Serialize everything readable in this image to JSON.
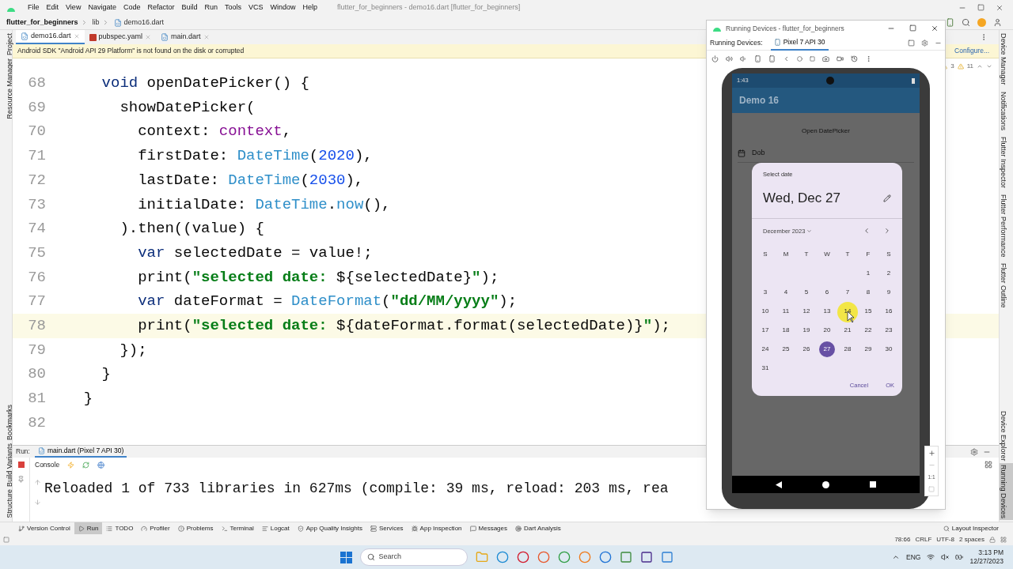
{
  "ide": {
    "menus": [
      "File",
      "Edit",
      "View",
      "Navigate",
      "Code",
      "Refactor",
      "Build",
      "Run",
      "Tools",
      "VCS",
      "Window",
      "Help"
    ],
    "title": "flutter_for_beginners - demo16.dart [flutter_for_beginners]",
    "breadcrumbs": [
      "flutter_for_beginners",
      "lib",
      "demo16.dart"
    ],
    "left_stripe": {
      "top": [
        "Project",
        "Resource Manager"
      ],
      "bottom": [
        "Bookmarks",
        "Build Variants",
        "Structure"
      ]
    },
    "editor_tabs": [
      {
        "label": "demo16.dart",
        "selected": true,
        "kind": "dart"
      },
      {
        "label": "pubspec.yaml",
        "selected": false,
        "kind": "yaml"
      },
      {
        "label": "main.dart",
        "selected": false,
        "kind": "dart"
      }
    ],
    "warning": {
      "text": "Android SDK \"Android API 29 Platform\" is not found on the disk or corrupted",
      "action": "Configure..."
    },
    "inspections": {
      "weak": "3",
      "warnings": "11"
    },
    "code_lines": [
      {
        "number": "68",
        "current": false,
        "tokens": [
          {
            "kind": "keyword",
            "text": "    void"
          },
          {
            "kind": "plain",
            "text": " openDatePicker() {"
          }
        ]
      },
      {
        "number": "69",
        "current": false,
        "tokens": [
          {
            "kind": "plain",
            "text": "      showDatePicker("
          }
        ]
      },
      {
        "number": "70",
        "current": false,
        "tokens": [
          {
            "kind": "plain",
            "text": "        context: "
          },
          {
            "kind": "param",
            "text": "context"
          },
          {
            "kind": "plain",
            "text": ","
          }
        ]
      },
      {
        "number": "71",
        "current": false,
        "tokens": [
          {
            "kind": "plain",
            "text": "        firstDate: "
          },
          {
            "kind": "type",
            "text": "DateTime"
          },
          {
            "kind": "plain",
            "text": "("
          },
          {
            "kind": "number",
            "text": "2020"
          },
          {
            "kind": "plain",
            "text": "),"
          }
        ]
      },
      {
        "number": "72",
        "current": false,
        "tokens": [
          {
            "kind": "plain",
            "text": "        lastDate: "
          },
          {
            "kind": "type",
            "text": "DateTime"
          },
          {
            "kind": "plain",
            "text": "("
          },
          {
            "kind": "number",
            "text": "2030"
          },
          {
            "kind": "plain",
            "text": "),"
          }
        ]
      },
      {
        "number": "73",
        "current": false,
        "tokens": [
          {
            "kind": "plain",
            "text": "        initialDate: "
          },
          {
            "kind": "type",
            "text": "DateTime"
          },
          {
            "kind": "plain",
            "text": "."
          },
          {
            "kind": "type",
            "text": "now"
          },
          {
            "kind": "plain",
            "text": "(),"
          }
        ]
      },
      {
        "number": "74",
        "current": false,
        "tokens": [
          {
            "kind": "plain",
            "text": "      ).then((value) {"
          }
        ]
      },
      {
        "number": "75",
        "current": false,
        "tokens": [
          {
            "kind": "keyword",
            "text": "        var"
          },
          {
            "kind": "plain",
            "text": " selectedDate = value!;"
          }
        ]
      },
      {
        "number": "76",
        "current": false,
        "tokens": [
          {
            "kind": "plain",
            "text": "        print("
          },
          {
            "kind": "string",
            "text": "\"selected date: "
          },
          {
            "kind": "plain",
            "text": "${selectedDate}"
          },
          {
            "kind": "string",
            "text": "\""
          },
          {
            "kind": "plain",
            "text": ");"
          }
        ]
      },
      {
        "number": "77",
        "current": false,
        "tokens": [
          {
            "kind": "keyword",
            "text": "        var"
          },
          {
            "kind": "plain",
            "text": " dateFormat = "
          },
          {
            "kind": "type",
            "text": "DateFormat"
          },
          {
            "kind": "plain",
            "text": "("
          },
          {
            "kind": "string",
            "text": "\"dd/MM/yyyy\""
          },
          {
            "kind": "plain",
            "text": ");"
          }
        ]
      },
      {
        "number": "78",
        "current": true,
        "tokens": [
          {
            "kind": "plain",
            "text": "        print("
          },
          {
            "kind": "string",
            "text": "\"selected date: "
          },
          {
            "kind": "plain",
            "text": "${dateFormat.format(selectedDate)}"
          },
          {
            "kind": "string",
            "text": "\""
          },
          {
            "kind": "plain",
            "text": ");"
          }
        ]
      },
      {
        "number": "79",
        "current": false,
        "tokens": [
          {
            "kind": "plain",
            "text": "      });"
          }
        ]
      },
      {
        "number": "80",
        "current": false,
        "tokens": [
          {
            "kind": "plain",
            "text": "    }"
          }
        ]
      },
      {
        "number": "81",
        "current": false,
        "tokens": [
          {
            "kind": "plain",
            "text": "  }"
          }
        ]
      },
      {
        "number": "82",
        "current": false
      }
    ],
    "right_stripe": {
      "top": [
        {
          "label": "Device Manager",
          "selected": false
        },
        {
          "label": "Notifications",
          "selected": false
        },
        {
          "label": "Flutter Inspector",
          "selected": false
        },
        {
          "label": "Flutter Performance",
          "selected": false
        },
        {
          "label": "Flutter Outline",
          "selected": false
        }
      ],
      "bottom": [
        {
          "label": "Device Explorer",
          "selected": false
        },
        {
          "label": "Running Devices",
          "selected": true
        }
      ]
    },
    "run_panel": {
      "label": "Run:",
      "tab": "main.dart (Pixel 7 API 30)",
      "console_tab": "Console",
      "output": "Reloaded 1 of 733 libraries in 627ms (compile: 39 ms, reload: 203 ms, rea"
    },
    "tool_windows": [
      {
        "label": "Version Control",
        "selected": false
      },
      {
        "label": "Run",
        "selected": true
      },
      {
        "label": "TODO",
        "selected": false
      },
      {
        "label": "Profiler",
        "selected": false
      },
      {
        "label": "Problems",
        "selected": false
      },
      {
        "label": "Terminal",
        "selected": false
      },
      {
        "label": "Logcat",
        "selected": false
      },
      {
        "label": "App Quality Insights",
        "selected": false
      },
      {
        "label": "Services",
        "selected": false
      },
      {
        "label": "App Inspection",
        "selected": false
      },
      {
        "label": "Messages",
        "selected": false
      },
      {
        "label": "Dart Analysis",
        "selected": false
      }
    ],
    "layout_inspector": "Layout Inspector",
    "status_bar": [
      "78:66",
      "CRLF",
      "UTF-8",
      "2 spaces"
    ]
  },
  "running_devices": {
    "title": "Running Devices - flutter_for_beginners",
    "label": "Running Devices:",
    "device_tab": "Pixel 7 API 30",
    "zoom_reset": "1:1",
    "phone": {
      "time": "1:43",
      "app_title": "Demo 16",
      "button": "Open DatePicker",
      "field_placeholder": "Dob",
      "dialog": {
        "heading": "Select date",
        "date": "Wed, Dec 27",
        "month": "December 2023",
        "weekdays": [
          "S",
          "M",
          "T",
          "W",
          "T",
          "F",
          "S"
        ],
        "weeks": [
          {
            "kind": "first",
            "days": [
              {
                "label": "1",
                "selected": false
              },
              {
                "label": "2",
                "selected": false
              }
            ]
          },
          {
            "kind": "regular",
            "days": [
              {
                "label": "3",
                "selected": false
              },
              {
                "label": "4",
                "selected": false
              },
              {
                "label": "5",
                "selected": false
              },
              {
                "label": "6",
                "selected": false
              },
              {
                "label": "7",
                "selected": false
              },
              {
                "label": "8",
                "selected": false
              },
              {
                "label": "9",
                "selected": false
              }
            ]
          },
          {
            "kind": "regular",
            "days": [
              {
                "label": "10",
                "selected": false
              },
              {
                "label": "11",
                "selected": false
              },
              {
                "label": "12",
                "selected": false
              },
              {
                "label": "13",
                "selected": false
              },
              {
                "label": "14",
                "selected": false
              },
              {
                "label": "15",
                "selected": false
              },
              {
                "label": "16",
                "selected": false
              }
            ]
          },
          {
            "kind": "regular",
            "days": [
              {
                "label": "17",
                "selected": false
              },
              {
                "label": "18",
                "selected": false
              },
              {
                "label": "19",
                "selected": false
              },
              {
                "label": "20",
                "selected": false
              },
              {
                "label": "21",
                "selected": false
              },
              {
                "label": "22",
                "selected": false
              },
              {
                "label": "23",
                "selected": false
              }
            ]
          },
          {
            "kind": "regular",
            "days": [
              {
                "label": "24",
                "selected": false
              },
              {
                "label": "25",
                "selected": false
              },
              {
                "label": "26",
                "selected": false
              },
              {
                "label": "27",
                "selected": true
              },
              {
                "label": "28",
                "selected": false
              },
              {
                "label": "29",
                "selected": false
              },
              {
                "label": "30",
                "selected": false
              }
            ]
          },
          {
            "kind": "regular",
            "days": [
              {
                "label": "31",
                "selected": false
              }
            ]
          }
        ],
        "actions": [
          "Cancel",
          "OK"
        ]
      }
    }
  },
  "taskbar": {
    "search": "Search",
    "language": "ENG",
    "time": "3:13 PM",
    "date": "12/27/2023"
  }
}
